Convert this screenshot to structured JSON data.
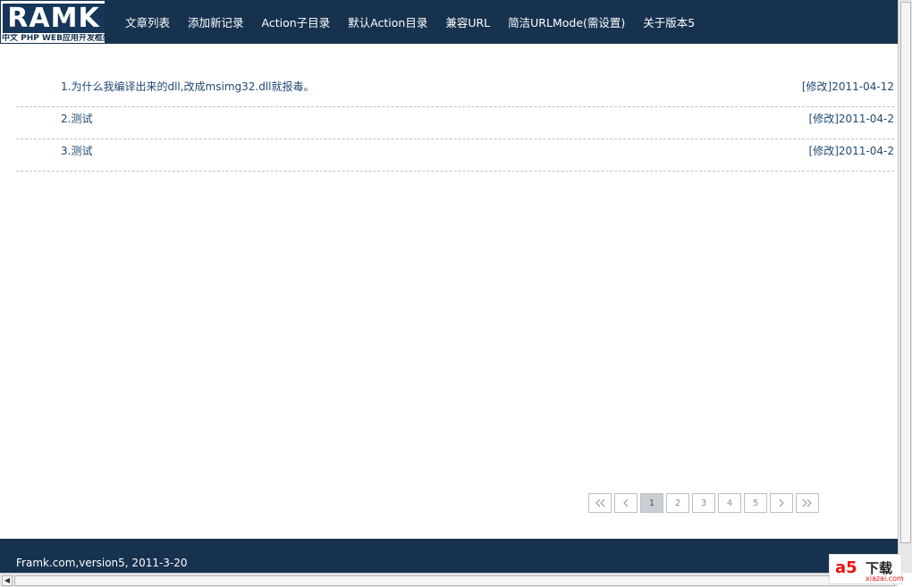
{
  "logo": {
    "mark": "RAMK",
    "subtitle": "中文 PHP WEB应用开发框架"
  },
  "nav": {
    "items": [
      {
        "label": "文章列表"
      },
      {
        "label": "添加新记录"
      },
      {
        "label": "Action子目录"
      },
      {
        "label": "默认Action目录"
      },
      {
        "label": "兼容URL"
      },
      {
        "label": "简洁URLMode(需设置)"
      },
      {
        "label": "关于版本5"
      }
    ]
  },
  "articles": [
    {
      "title": "1.为什么我编译出来的dll,改成msimg32.dll就报毒。",
      "edit_label": "[修改]",
      "date": "2011-04-12"
    },
    {
      "title": "2.测试",
      "edit_label": "[修改]",
      "date": "2011-04-2"
    },
    {
      "title": "3.测试",
      "edit_label": "[修改]",
      "date": "2011-04-2"
    }
  ],
  "pager": {
    "pages": [
      "1",
      "2",
      "3",
      "4",
      "5"
    ],
    "current": "1"
  },
  "footer": {
    "text": "Framk.com,version5, 2011-3-20"
  },
  "watermark": {
    "mark": "a5",
    "text": "下载",
    "sub": "xiazai.com"
  },
  "colors": {
    "header_bg": "#17324f",
    "link": "#1f4a73"
  }
}
